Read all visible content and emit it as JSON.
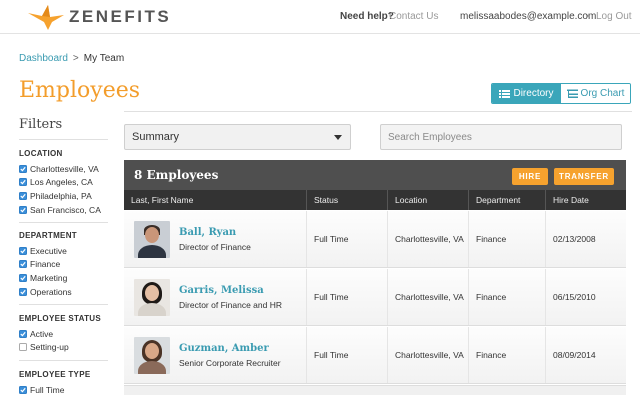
{
  "brand": {
    "name": "ZENEFITS",
    "accent": "#f6a22e",
    "teal": "#3aa6ba"
  },
  "header": {
    "help_label": "Need help?",
    "contact_label": "Contact Us",
    "user_email": "melissaabodes@example.com",
    "separator": "•",
    "logout_label": "Log Out"
  },
  "breadcrumb": {
    "root": "Dashboard",
    "separator": ">",
    "current": "My Team"
  },
  "page": {
    "title": "Employees"
  },
  "view_toggle": {
    "directory": "Directory",
    "org_chart": "Org Chart",
    "active": "Directory"
  },
  "filters": {
    "title": "Filters",
    "location": {
      "title": "LOCATION",
      "items": [
        {
          "label": "Charlottesville, VA",
          "checked": true
        },
        {
          "label": "Los Angeles, CA",
          "checked": true
        },
        {
          "label": "Philadelphia, PA",
          "checked": true
        },
        {
          "label": "San Francisco, CA",
          "checked": true
        }
      ]
    },
    "department": {
      "title": "DEPARTMENT",
      "items": [
        {
          "label": "Executive",
          "checked": true
        },
        {
          "label": "Finance",
          "checked": true
        },
        {
          "label": "Marketing",
          "checked": true
        },
        {
          "label": "Operations",
          "checked": true
        }
      ]
    },
    "status": {
      "title": "EMPLOYEE STATUS",
      "items": [
        {
          "label": "Active",
          "checked": true
        },
        {
          "label": "Setting-up",
          "checked": false
        }
      ]
    },
    "type": {
      "title": "EMPLOYEE TYPE",
      "items": [
        {
          "label": "Full Time",
          "checked": true
        }
      ]
    }
  },
  "controls": {
    "summary_select": "Summary",
    "search_placeholder": "Search Employees"
  },
  "table": {
    "count_label": "8 Employees",
    "hire_label": "HIRE",
    "transfer_label": "TRANSFER",
    "columns": [
      "Last, First Name",
      "Status",
      "Location",
      "Department",
      "Hire Date"
    ],
    "rows": [
      {
        "name": "Ball, Ryan",
        "title": "Director of Finance",
        "status": "Full Time",
        "location": "Charlottesville, VA",
        "department": "Finance",
        "hire_date": "02/13/2008"
      },
      {
        "name": "Garris, Melissa",
        "title": "Director of Finance and HR",
        "status": "Full Time",
        "location": "Charlottesville, VA",
        "department": "Finance",
        "hire_date": "06/15/2010"
      },
      {
        "name": "Guzman, Amber",
        "title": "Senior Corporate Recruiter",
        "status": "Full Time",
        "location": "Charlottesville, VA",
        "department": "Finance",
        "hire_date": "08/09/2014"
      }
    ]
  }
}
